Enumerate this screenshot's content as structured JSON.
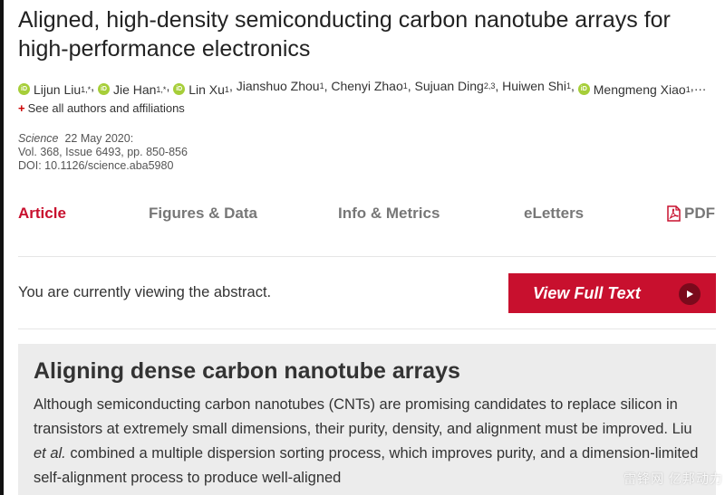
{
  "article": {
    "title": "Aligned, high-density semiconducting carbon nanotube arrays for high-performance electronics",
    "authors": [
      {
        "name": "Lijun Liu",
        "sup": "1,*",
        "orcid": true
      },
      {
        "name": "Jie Han",
        "sup": "1,*",
        "orcid": true
      },
      {
        "name": "Lin Xu",
        "sup": "1",
        "orcid": true
      },
      {
        "name": "Jianshuo Zhou",
        "sup": "1",
        "orcid": false
      },
      {
        "name": "Chenyi Zhao",
        "sup": "1",
        "orcid": false
      },
      {
        "name": "Sujuan Ding",
        "sup": "2,3",
        "orcid": false
      },
      {
        "name": "Huiwen Shi",
        "sup": "1",
        "orcid": false
      },
      {
        "name": "Mengmeng Xiao",
        "sup": "1",
        "orcid": true
      }
    ],
    "authors_ellipsis": "…",
    "see_all_label": "See all authors and affiliations",
    "journal": "Science",
    "date": "22 May 2020:",
    "volume": "Vol. 368, Issue 6493, pp. 850-856",
    "doi": "DOI: 10.1126/science.aba5980"
  },
  "tabs": [
    {
      "label": "Article",
      "active": true
    },
    {
      "label": "Figures & Data",
      "active": false
    },
    {
      "label": "Info & Metrics",
      "active": false
    },
    {
      "label": "eLetters",
      "active": false
    },
    {
      "label": "PDF",
      "active": false,
      "icon": "pdf-icon"
    }
  ],
  "access": {
    "status_text": "You are currently viewing the abstract.",
    "button_label": "View Full Text",
    "button_icon": "play-icon"
  },
  "summary": {
    "heading": "Aligning dense carbon nanotube arrays",
    "text_before_em": "Although semiconducting carbon nanotubes (CNTs) are promising candidates to replace silicon in transistors at extremely small dimensions, their purity, density, and alignment must be improved. Liu ",
    "em_text": "et al.",
    "text_after_em": " combined a multiple dispersion sorting process, which improves purity, and a dimension-limited self-alignment process to produce well-aligned"
  },
  "watermark": "雷锋网 亿邦动力",
  "colors": {
    "accent": "#c8102e",
    "orcid": "#a6ce39",
    "panel_bg": "#ececec"
  }
}
